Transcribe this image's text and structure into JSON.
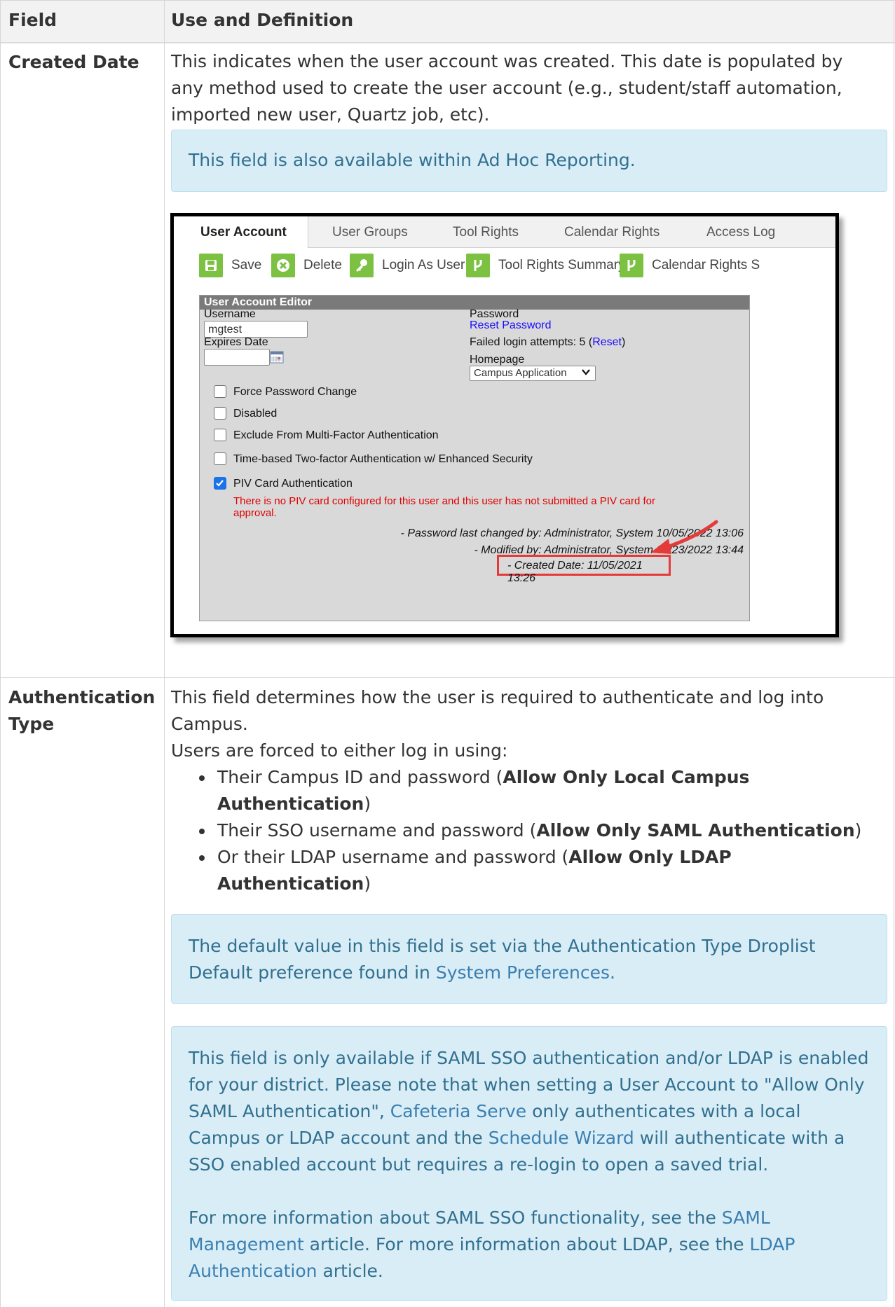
{
  "table": {
    "header_field": "Field",
    "header_use": "Use and Definition"
  },
  "created_date": {
    "field": "Created Date",
    "desc": "This indicates when the user account was created. This date is populated by any method used to create the user account (e.g., student/staff automation, imported new user, Quartz job, etc).",
    "note": "This field is also available within Ad Hoc Reporting."
  },
  "screenshot": {
    "tabs": [
      "User Account",
      "User Groups",
      "Tool Rights",
      "Calendar Rights",
      "Access Log"
    ],
    "toolbar": {
      "save": "Save",
      "delete": "Delete",
      "login_as_user": "Login As User",
      "tool_rights_summary": "Tool Rights Summary",
      "calendar_rights": "Calendar Rights S"
    },
    "editor_title": "User Account Editor",
    "username_label": "Username",
    "username_value": "mgtest",
    "expires_label": "Expires Date",
    "password_label": "Password",
    "reset_password": "Reset Password",
    "failed_prefix": "Failed login attempts: 5 (",
    "failed_reset": "Reset",
    "failed_suffix": ")",
    "homepage_label": "Homepage",
    "homepage_value": "Campus Application",
    "checkboxes": [
      {
        "label": "Force Password Change",
        "checked": false
      },
      {
        "label": "Disabled",
        "checked": false
      },
      {
        "label": "Exclude From Multi-Factor Authentication",
        "checked": false
      },
      {
        "label": "Time-based Two-factor Authentication w/ Enhanced Security",
        "checked": false
      },
      {
        "label": "PIV Card Authentication",
        "checked": true
      }
    ],
    "piv_error": "There is no PIV card configured for this user and this user has not submitted a PIV card for approval.",
    "password_changed": "- Password last changed by: Administrator, System 10/05/2022 13:06",
    "modified_by": "- Modified by: Administrator, System 09/23/2022 13:44",
    "created_date": "- Created Date: 11/05/2021 13:26",
    "colors": {
      "highlight": "#e53a3a",
      "button_green": "#7cc142",
      "link": "#1a0dff",
      "error": "#e00000"
    }
  },
  "auth_type": {
    "field_line1": "Authentication",
    "field_line2": "Type",
    "desc1": "This field determines how the user is required to authenticate and log into Campus.",
    "desc2": "Users are forced to either log in using:",
    "options": [
      {
        "text": "Their Campus ID and password (",
        "bold": "Allow Only Local Campus Authentication",
        "end": ")"
      },
      {
        "text": "Their SSO username and password (",
        "bold": "Allow Only SAML Authentication",
        "end": ")"
      },
      {
        "text": "Or their LDAP username and password (",
        "bold": "Allow Only LDAP Authentication",
        "end": ")"
      }
    ],
    "note1_text": "The default value in this field is set via the Authentication Type Droplist Default preference found in ",
    "note1_link": "System Preferences",
    "note1_end": ".",
    "note2_p1_a": "This field is only available if SAML SSO authentication and/or LDAP is enabled for your district. Please note that when setting a User Account to \"Allow Only SAML Authentication\", ",
    "note2_link_cafeteria": "Cafeteria Serve",
    "note2_p1_b": " only authenticates with a local Campus or LDAP account and the ",
    "note2_link_wizard": "Schedule Wizard",
    "note2_p1_c": " will authenticate with a SSO enabled account but requires a re-login to open a saved trial.",
    "note2_p2_a": "For more information about SAML SSO functionality, see the ",
    "note2_link_saml": "SAML Management",
    "note2_p2_b": " article. For more information about LDAP, see the ",
    "note2_link_ldap": "LDAP Authentication",
    "note2_p2_c": " article."
  }
}
